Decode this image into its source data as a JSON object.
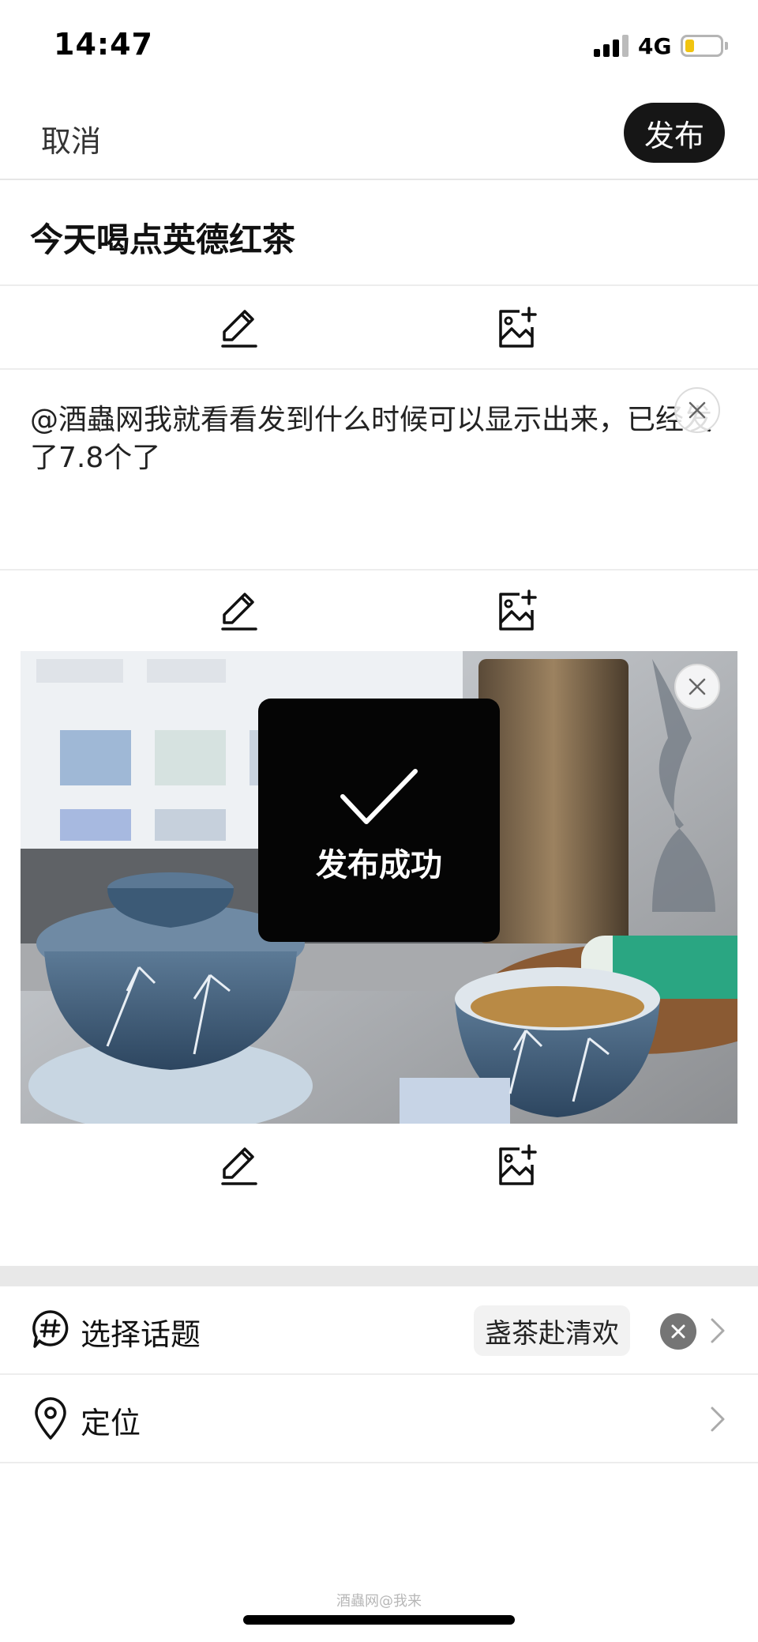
{
  "status_bar": {
    "time": "14:47",
    "network": "4G",
    "battery_level": 0.25,
    "battery_color": "#f1c40f"
  },
  "nav": {
    "cancel_label": "取消",
    "publish_label": "发布"
  },
  "note": {
    "title": "今天喝点英德红茶",
    "text": "@酒蟲网我就看看发到什么时候可以显示出来，已经发了7.8个了"
  },
  "toolbar_icons": [
    "pencil-icon",
    "image-add-icon"
  ],
  "toast": {
    "message": "发布成功",
    "icon": "checkmark-icon"
  },
  "topic": {
    "label": "选择话题",
    "selected": "盏茶赴清欢",
    "icon": "hashtag-bubble-icon"
  },
  "location": {
    "label": "定位",
    "icon": "location-pin-icon"
  },
  "watermark": "酒蟲网@我来",
  "colors": {
    "accent_dark": "#161616",
    "divider": "#e8e8e8"
  }
}
